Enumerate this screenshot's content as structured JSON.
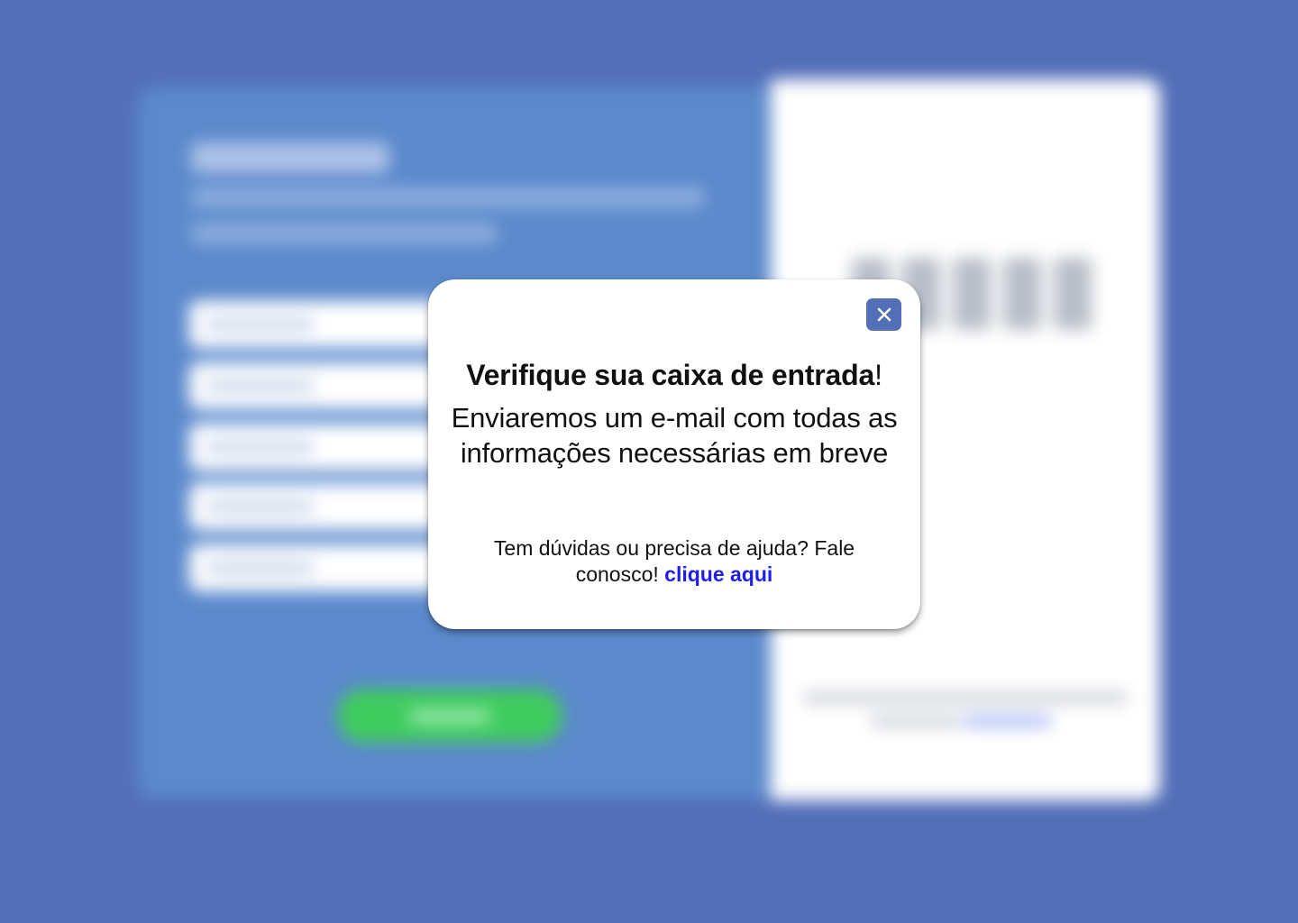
{
  "modal": {
    "title_bold": "Verifique sua caixa de entrada",
    "title_punct": "!",
    "message": "Enviaremos um e-mail com todas as informações necessárias em breve",
    "help_text": "Tem dúvidas ou precisa de ajuda? Fale conosco!",
    "help_link": "clique aqui",
    "close_icon": "close-icon"
  },
  "colors": {
    "background": "#536fb8",
    "left_panel": "#5b89cc",
    "right_panel": "#ffffff",
    "submit_button": "#3fcc5e",
    "close_button": "#536fb8",
    "link": "#1f1df0"
  }
}
